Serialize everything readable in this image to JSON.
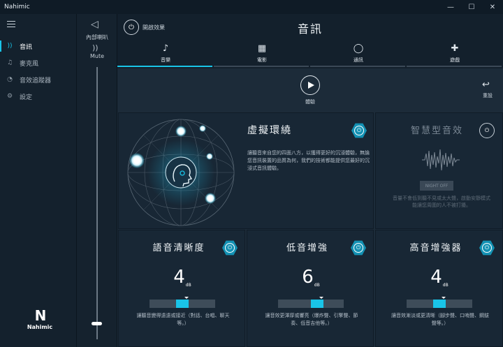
{
  "window": {
    "title": "Nahimic",
    "minimize": "—",
    "maximize": "☐",
    "close": "✕"
  },
  "sidebar": {
    "items": [
      {
        "label": "音訊",
        "icon": "audio-wave-icon",
        "glyph": "))",
        "active": true
      },
      {
        "label": "麥克風",
        "icon": "microphone-icon",
        "glyph": "🎙",
        "active": false
      },
      {
        "label": "音效追蹤器",
        "icon": "sound-tracker-icon",
        "glyph": "◔",
        "active": false
      },
      {
        "label": "設定",
        "icon": "gear-icon",
        "glyph": "⚙",
        "active": false
      }
    ],
    "logo_text": "Nahimic"
  },
  "volume": {
    "device_label": "內部喇叭",
    "mute_label": "Mute",
    "level": 0.06
  },
  "header": {
    "master_label": "開啟效果",
    "title": "音訊"
  },
  "tabs": [
    {
      "label": "音樂",
      "icon": "music-note-icon",
      "glyph": "♪",
      "active": true
    },
    {
      "label": "電影",
      "icon": "film-clapper-icon",
      "glyph": "🎬",
      "active": false
    },
    {
      "label": "通訊",
      "icon": "chat-bubble-icon",
      "glyph": "💬",
      "active": false
    },
    {
      "label": "遊戲",
      "icon": "gamepad-icon",
      "glyph": "🎮",
      "active": false
    }
  ],
  "playback": {
    "play_label": "體驗",
    "reset_label": "重設"
  },
  "virtual_surround": {
    "title": "虛擬環繞",
    "description": "讓聽音來自您的四面八方，以獲得更好的沉浸體驗，無論您音訊裝置的品質為何，我們的技術都能提供您最好的沉浸式音訊體驗。"
  },
  "smart_volume": {
    "title": "智慧型音效",
    "toggle_label": "NIGHT OFF",
    "description": "音量不會低到聽不見或太大聲，啟動安靜模式能讓您周圍的人不被打擾。"
  },
  "effects": [
    {
      "title": "語音清晰度",
      "value": "4",
      "unit": "dB",
      "level": 0.5,
      "description": "讓聽音變得遠遠或接近（對話、台唱、聊天等。）"
    },
    {
      "title": "低音增強",
      "value": "6",
      "unit": "dB",
      "level": 0.6,
      "description": "讓音效更渾厚或響亮（爆炸聲、引擎聲、節奏、低音吉他等。）"
    },
    {
      "title": "高音增強器",
      "value": "4",
      "unit": "dB",
      "level": 0.5,
      "description": "讓音效漸淡或更清晰（腳步聲、口哨聲、鋼鈸聲等。）"
    }
  ],
  "colors": {
    "accent": "#19c4e8",
    "background": "#1c2b39",
    "panel": "#182735"
  }
}
